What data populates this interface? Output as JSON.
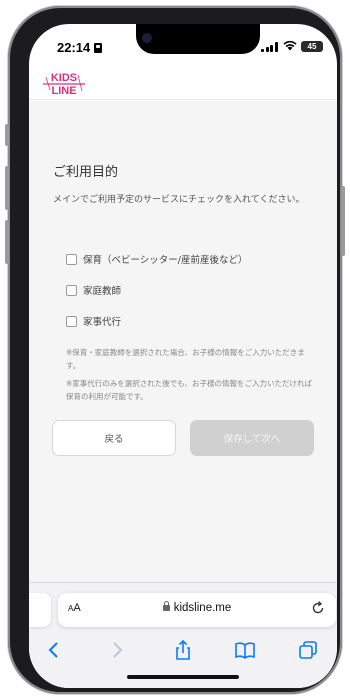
{
  "status_bar": {
    "time": "22:14",
    "battery": "45"
  },
  "header": {
    "logo_text_top": "KIDS",
    "logo_text_bottom": "LINE"
  },
  "form": {
    "title": "ご利用目的",
    "description": "メインでご利用予定のサービスにチェックを入れてください。",
    "options": [
      {
        "label": "保育（ベビーシッター/産前産後など）",
        "checked": false
      },
      {
        "label": "家庭教師",
        "checked": false
      },
      {
        "label": "家事代行",
        "checked": false
      }
    ],
    "notes": [
      "※保育・家庭教師を選択された場合、お子様の情報をご入力いただきます。",
      "※家事代行のみを選択された後でも、お子様の情報をご入力いただければ保育の利用が可能です。"
    ],
    "back_label": "戻る",
    "next_label": "保存して次へ"
  },
  "browser": {
    "text_size_label": "AA",
    "url": "kidsline.me"
  },
  "colors": {
    "brand_pink": "#d6337f",
    "page_bg": "#f5f5f5",
    "disabled_button": "#d0d0d0"
  }
}
